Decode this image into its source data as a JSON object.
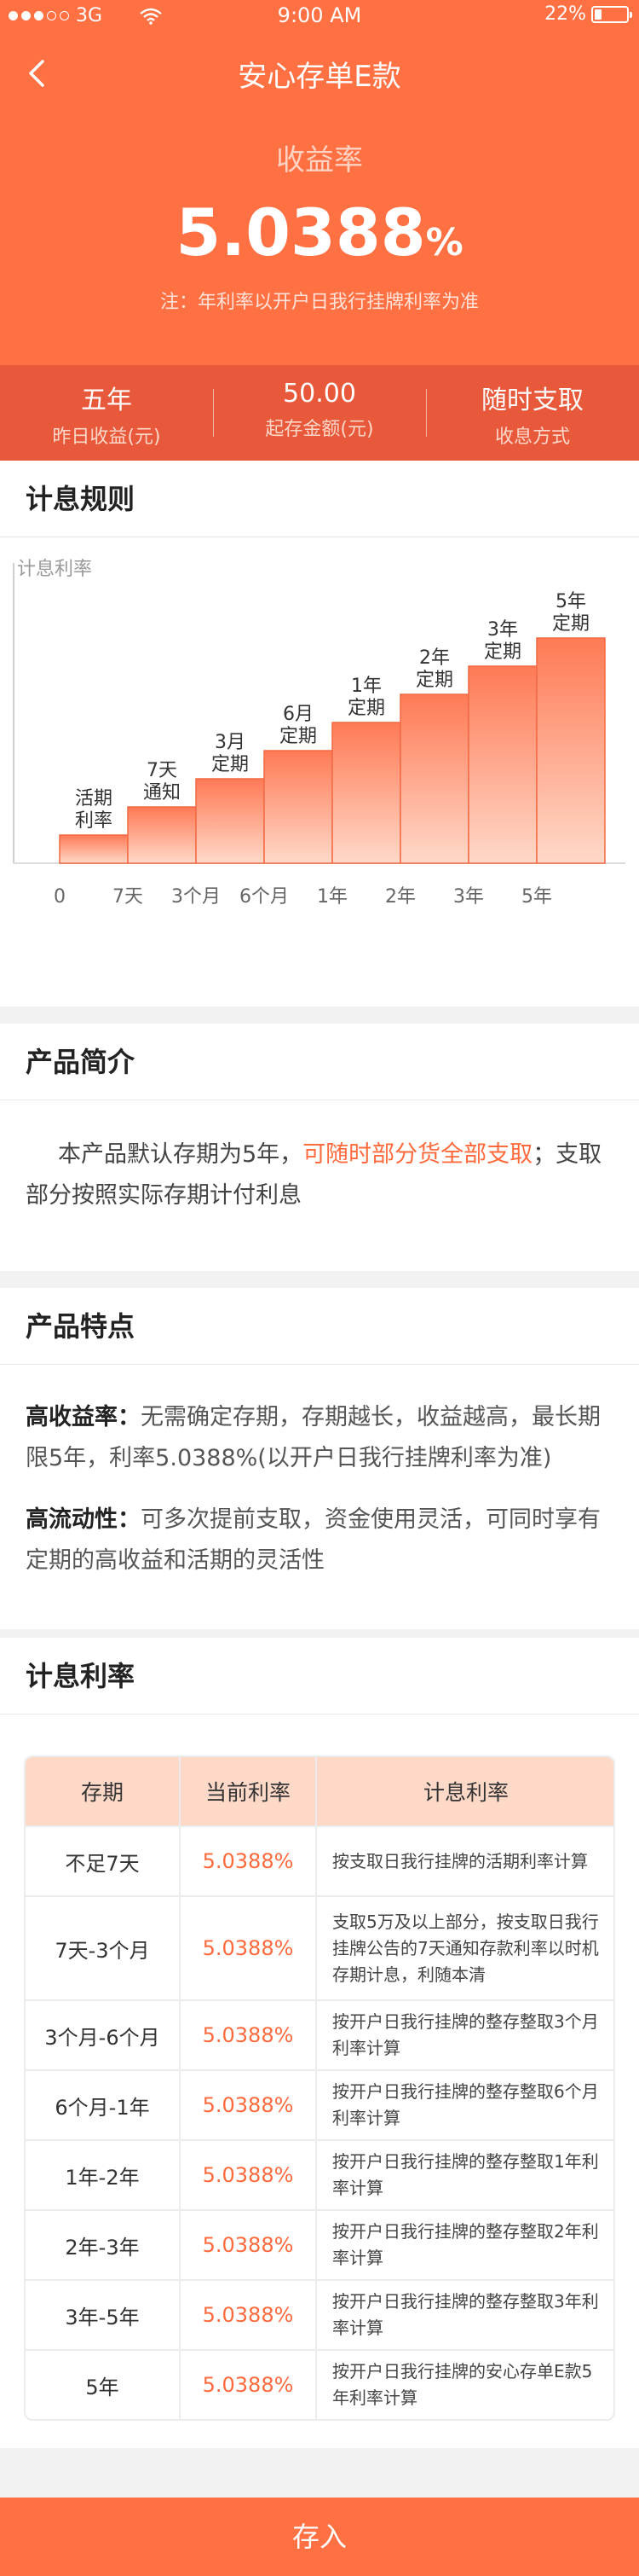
{
  "status_bar": {
    "carrier": "3G",
    "time": "9:00 AM",
    "battery_text": "22%",
    "battery_level": 0.22
  },
  "nav": {
    "title": "安心存单E款",
    "back_icon": "chevron-left-icon"
  },
  "hero": {
    "yield_label": "收益率",
    "yield_number": "5.0388",
    "yield_unit": "%",
    "note": "注：年利率以开户日我行挂牌利率为准"
  },
  "stats": [
    {
      "value": "五年",
      "label": "昨日收益(元)"
    },
    {
      "value": "50.00",
      "label": "起存金额(元)"
    },
    {
      "value": "随时支取",
      "label": "收息方式"
    }
  ],
  "rules": {
    "title": "计息规则",
    "chart_data": {
      "type": "bar",
      "ylabel": "计息利率",
      "x_ticks": [
        "0",
        "7天",
        "3个月",
        "6个月",
        "1年",
        "2年",
        "3年",
        "5年"
      ],
      "categories": [
        "活期\n利率",
        "7天\n通知",
        "3月\n定期",
        "6月\n定期",
        "1年\n定期",
        "2年\n定期",
        "3年\n定期",
        "5年\n定期"
      ],
      "values": [
        1,
        2,
        3,
        4,
        5,
        6,
        7,
        8
      ],
      "grid": false
    }
  },
  "intro": {
    "title": "产品简介",
    "text_pre": "本产品默认存期为5年，",
    "text_highlight": "可随时部分货全部支取",
    "text_post": "；支取部分按照实际存期计付利息"
  },
  "features": {
    "title": "产品特点",
    "items": [
      {
        "label": "高收益率：",
        "text": "无需确定存期，存期越长，收益越高，最长期限5年，利率5.0388%(以开户日我行挂牌利率为准)"
      },
      {
        "label": "高流动性：",
        "text": "可多次提前支取，资金使用灵活，可同时享有定期的高收益和活期的灵活性"
      }
    ]
  },
  "rates": {
    "title": "计息利率",
    "headers": [
      "存期",
      "当前利率",
      "计息利率"
    ],
    "rows": [
      {
        "term": "不足7天",
        "rate": "5.0388%",
        "desc": "按支取日我行挂牌的活期利率计算"
      },
      {
        "term": "7天-3个月",
        "rate": "5.0388%",
        "desc": "支取5万及以上部分，按支取日我行挂牌公告的7天通知存款利率以时机存期计息，利随本清"
      },
      {
        "term": "3个月-6个月",
        "rate": "5.0388%",
        "desc": "按开户日我行挂牌的整存整取3个月利率计算"
      },
      {
        "term": "6个月-1年",
        "rate": "5.0388%",
        "desc": "按开户日我行挂牌的整存整取6个月利率计算"
      },
      {
        "term": "1年-2年",
        "rate": "5.0388%",
        "desc": "按开户日我行挂牌的整存整取1年利率计算"
      },
      {
        "term": "2年-3年",
        "rate": "5.0388%",
        "desc": "按开户日我行挂牌的整存整取2年利率计算"
      },
      {
        "term": "3年-5年",
        "rate": "5.0388%",
        "desc": "按开户日我行挂牌的整存整取3年利率计算"
      },
      {
        "term": "5年",
        "rate": "5.0388%",
        "desc": "按开户日我行挂牌的安心存单E款5年利率计算"
      }
    ]
  },
  "footer": {
    "deposit_label": "存入"
  },
  "colors": {
    "primary": "#ff7043",
    "stats_bg": "#e8583a",
    "highlight": "#ff6a3d",
    "table_head": "#ffd9c8"
  }
}
